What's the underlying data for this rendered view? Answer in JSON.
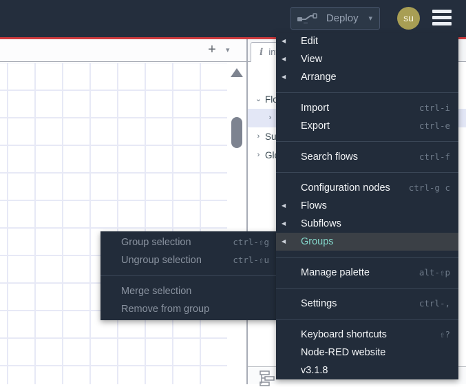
{
  "colors": {
    "accent_red": "#cf3b3e",
    "header_bg": "#242e3d",
    "menu_bg": "#222c3a",
    "menu_highlight_bg": "#3b4046",
    "menu_highlight_text": "#82d5c9",
    "avatar_bg": "#a89e54",
    "tree_selected_bg": "#e3e7f6"
  },
  "icons": {
    "plus": "+",
    "caret_down": "▾",
    "menu_arrow": "◀",
    "tree_expanded": "⌄",
    "tree_collapsed": "›"
  },
  "header": {
    "deploy_label": "Deploy",
    "user_initials": "su"
  },
  "sidebar": {
    "tab": {
      "icon": "i",
      "label": "info"
    },
    "tree": [
      {
        "label": "Flows",
        "state": "expanded",
        "selected": false
      },
      {
        "label": "",
        "state": "collapsed",
        "selected": true
      },
      {
        "label": "Subflows",
        "state": "collapsed",
        "selected": false
      },
      {
        "label": "Global Configuration Nodes",
        "state": "collapsed",
        "selected": false
      }
    ]
  },
  "menu": {
    "sections": [
      {
        "items": [
          {
            "label": "Edit",
            "submenu": true
          },
          {
            "label": "View",
            "submenu": true
          },
          {
            "label": "Arrange",
            "submenu": true
          }
        ]
      },
      {
        "items": [
          {
            "label": "Import",
            "shortcut": "ctrl-i"
          },
          {
            "label": "Export",
            "shortcut": "ctrl-e"
          }
        ]
      },
      {
        "items": [
          {
            "label": "Search flows",
            "shortcut": "ctrl-f"
          }
        ]
      },
      {
        "items": [
          {
            "label": "Configuration nodes",
            "shortcut": "ctrl-g c"
          },
          {
            "label": "Flows",
            "submenu": true
          },
          {
            "label": "Subflows",
            "submenu": true
          },
          {
            "label": "Groups",
            "submenu": true,
            "highlighted": true
          }
        ]
      },
      {
        "items": [
          {
            "label": "Manage palette",
            "shortcut": "alt-⇧p"
          }
        ]
      },
      {
        "items": [
          {
            "label": "Settings",
            "shortcut": "ctrl-,"
          }
        ]
      },
      {
        "items": [
          {
            "label": "Keyboard shortcuts",
            "shortcut": "⇧?"
          },
          {
            "label": "Node-RED website"
          },
          {
            "label": "v3.1.8"
          }
        ]
      }
    ]
  },
  "submenu": {
    "sections": [
      {
        "items": [
          {
            "label": "Group selection",
            "shortcut": "ctrl-⇧g",
            "disabled": true
          },
          {
            "label": "Ungroup selection",
            "shortcut": "ctrl-⇧u",
            "disabled": true
          }
        ]
      },
      {
        "items": [
          {
            "label": "Merge selection",
            "disabled": true
          },
          {
            "label": "Remove from group",
            "disabled": true
          }
        ]
      }
    ]
  }
}
